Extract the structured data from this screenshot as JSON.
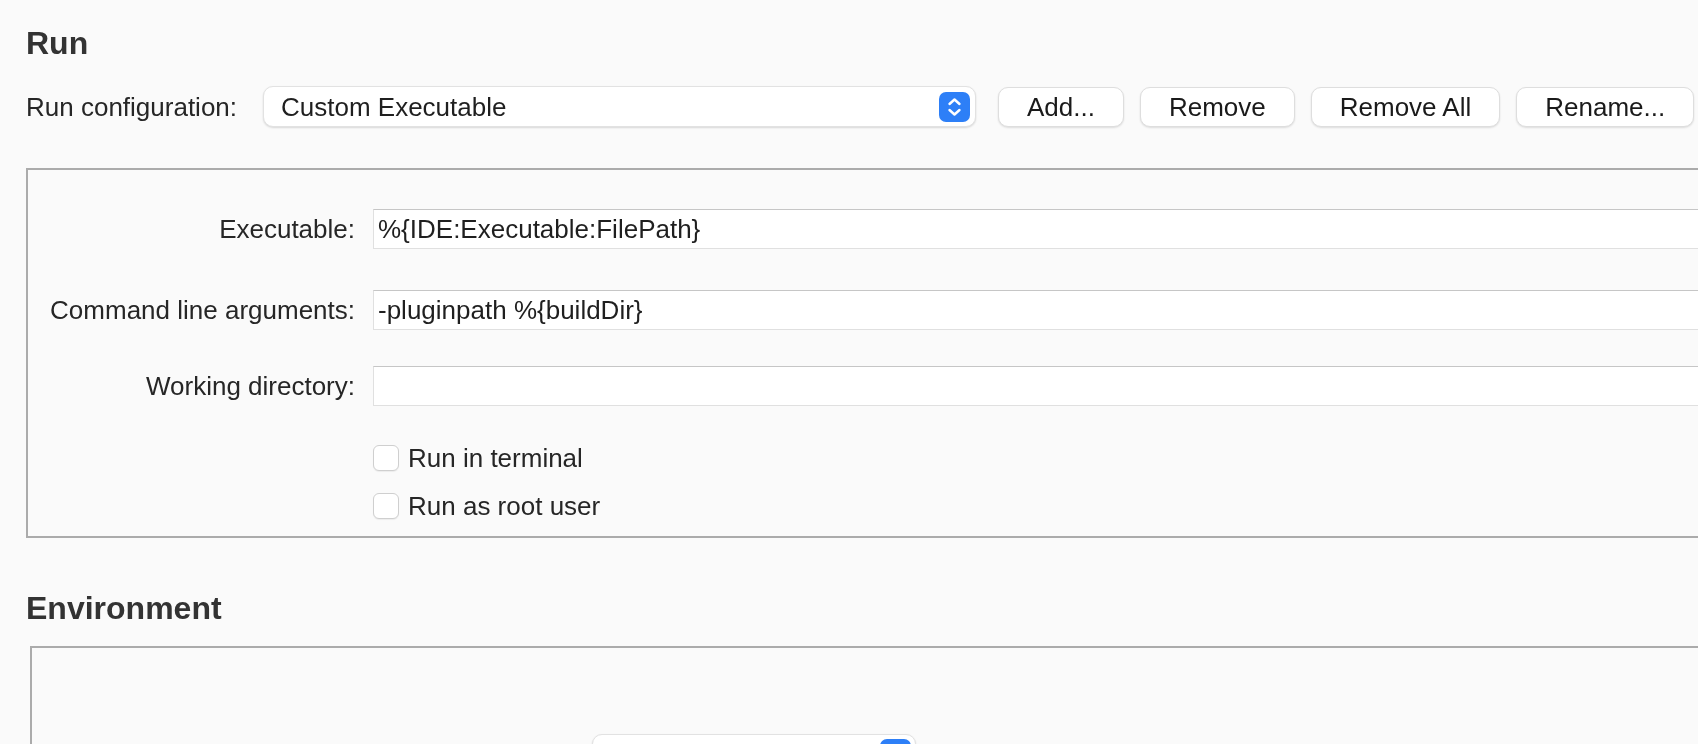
{
  "run": {
    "title": "Run",
    "configuration": {
      "label": "Run configuration:",
      "value": "Custom Executable"
    },
    "buttons": [
      "Add...",
      "Remove",
      "Remove All",
      "Rename..."
    ],
    "fields": [
      {
        "label": "Executable:",
        "value": "%{IDE:Executable:FilePath}"
      },
      {
        "label": "Command line arguments:",
        "value": "-pluginpath %{buildDir}"
      },
      {
        "label": "Working directory:"
      }
    ],
    "options": [
      {
        "label": "Run in terminal",
        "checked": false
      },
      {
        "label": "Run as root user",
        "checked": false
      }
    ]
  },
  "environment": {
    "title": "Environment"
  }
}
